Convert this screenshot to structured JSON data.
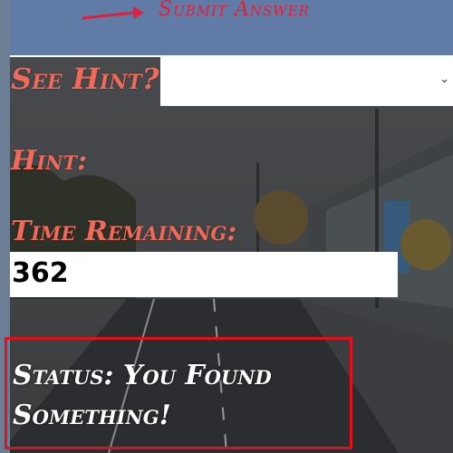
{
  "toolbar": {
    "submit_label": "Submit Answer",
    "accent_color": "#e0203a",
    "bar_color": "#5f7ba6"
  },
  "hint_select": {
    "label": "See Hint?",
    "selected_value": "",
    "icon": "chevron-down-icon"
  },
  "hint": {
    "label": "Hint:"
  },
  "timer": {
    "label": "Time Remaining:",
    "value": "362"
  },
  "status": {
    "text": "Status: You Found Something!",
    "border_color": "#e0101c"
  },
  "colors": {
    "label_color": "#f06a5a"
  }
}
